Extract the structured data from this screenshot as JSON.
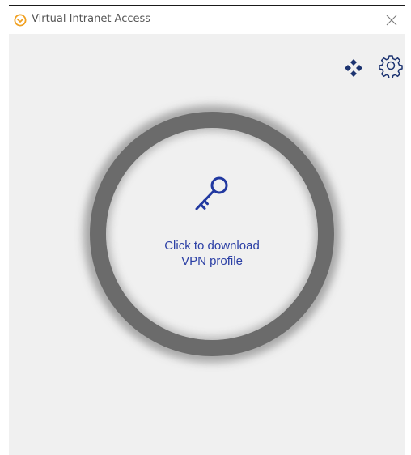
{
  "window": {
    "title": "Virtual Intranet Access",
    "app_icon": "chevron-circle-icon",
    "close_icon": "close-icon"
  },
  "toolbar": {
    "network_icon": "network-diamond-icon",
    "settings_icon": "gear-icon"
  },
  "main": {
    "connect_button": {
      "icon": "key-icon",
      "label_line1": "Click to download",
      "label_line2": "VPN profile"
    }
  },
  "colors": {
    "accent": "#2b3fa5",
    "icon_navy": "#1c3370",
    "ring_gray": "#6b6b6b",
    "app_icon_orange": "#f0a020"
  }
}
